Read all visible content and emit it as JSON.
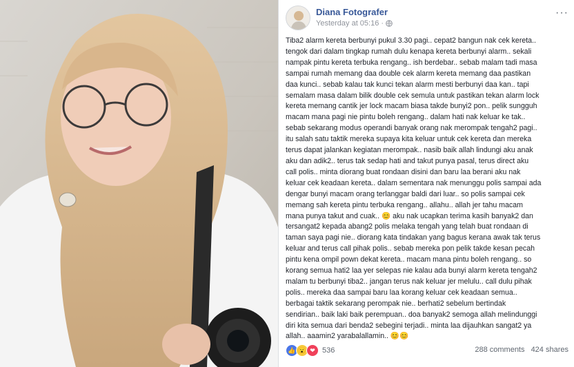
{
  "post": {
    "author": "Diana Fotografer",
    "timestamp": "Yesterday at 05:16",
    "more_label": "···",
    "lines": [
      "Tiba2 alarm kereta berbunyi pukul 3.30 pagi.. cepat2 bangun nak cek kereta..",
      "tengok dari dalam tingkap rumah dulu kenapa kereta berbunyi alarm.. sekali",
      "nampak pintu kereta terbuka rengang.. ish berdebar.. sebab malam tadi masa",
      "sampai rumah memang daa double cek alarm kereta memang daa pastikan",
      "daa kunci.. sebab kalau tak kunci tekan alarm mesti berbunyi daa kan.. tapi",
      "semalam masa dalam bilik double cek semula untuk pastikan tekan alarm lock",
      "kereta memang cantik jer lock macam biasa takde bunyi2 pon.. pelik sungguh",
      "macam mana pagi nie pintu boleh rengang.. dalam hati nak keluar ke tak..",
      "sebab sekarang modus operandi banyak orang nak merompak tengah2 pagi..",
      "itu salah satu taktik mereka supaya kita keluar untuk cek kereta dan mereka",
      "terus dapat jalankan kegiatan merompak.. nasib baik allah lindungi aku anak",
      "aku dan adik2.. terus tak sedap hati and takut punya pasal, terus direct aku",
      "call polis.. minta diorang buat rondaan disini dan baru laa berani aku nak",
      "keluar cek keadaan kereta.. dalam sementara nak menunggu polis sampai ada",
      "dengar bunyi macam orang terlanggar baldi dari luar.. so polis sampai cek",
      "memang sah kereta pintu terbuka rengang.. allahu.. allah jer tahu macam",
      "mana punya takut and cuak.. 😊 aku nak ucapkan terima kasih banyak2 dan",
      "tersangat2 kepada abang2 polis melaka tengah yang telah buat rondaan di",
      "taman saya pagi nie.. diorang kata tindakan yang bagus kerana awak tak terus",
      "keluar and terus call pihak polis.. sebab mereka pon pelik takde kesan pecah",
      "pintu kena ompil pown dekat kereta.. macam mana pintu boleh rengang.. so",
      "korang semua hati2 laa yer selepas nie kalau ada bunyi alarm kereta tengah2",
      "malam tu berbunyi tiba2.. jangan terus nak keluar jer melulu.. call dulu pihak",
      "polis.. mereka daa sampai baru laa korang keluar cek keadaan semua..",
      "berbagai taktik sekarang perompak nie.. berhati2 sebelum bertindak",
      "sendirian.. baik laki baik perempuan.. doa banyak2 semoga allah melindunggi",
      "diri kita semua dari benda2 sebegini terjadi.. minta laa dijauhkan sangat2 ya",
      "allah.. aaamin2 yarabalallamin.. 😊😊"
    ]
  },
  "reactions": {
    "count": "536",
    "icons": [
      "like-icon",
      "wow-icon",
      "love-icon"
    ],
    "colors": {
      "like": "#4a76e8",
      "wow": "#f7c93c",
      "love": "#f0405a"
    }
  },
  "stats": {
    "comments": "288 comments",
    "shares": "424 shares"
  },
  "theme": {
    "author_color": "#385898",
    "meta_color": "#90949c",
    "text_color": "#1d2129"
  }
}
